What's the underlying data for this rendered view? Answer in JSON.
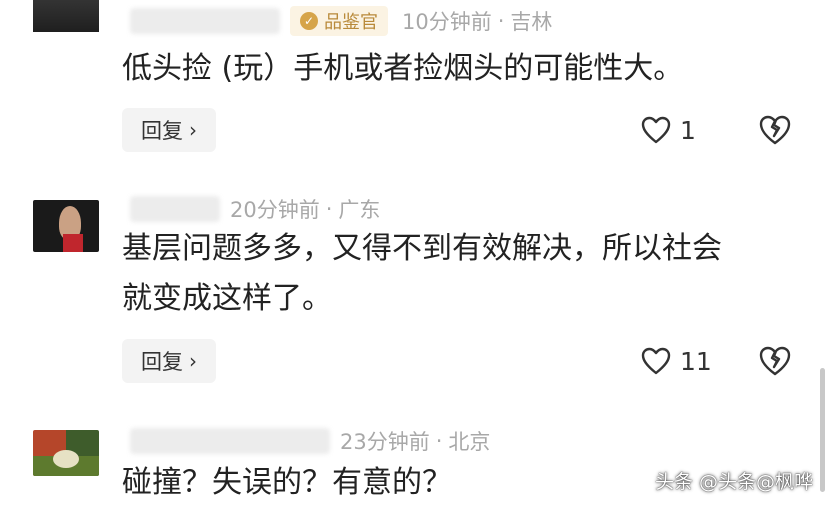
{
  "comments": [
    {
      "badge": "品鉴官",
      "time": "10分钟前",
      "location": "吉林",
      "text_lines": [
        "低头捡 (玩）手机或者捡烟头的可能性大。"
      ],
      "reply_label": "回复",
      "likes": "1"
    },
    {
      "time": "20分钟前",
      "location": "广东",
      "text_lines": [
        "基层问题多多，又得不到有效解决，所以社会",
        "就变成这样了。"
      ],
      "reply_label": "回复",
      "likes": "11"
    },
    {
      "time": "23分钟前",
      "location": "北京",
      "text_lines": [
        "碰撞？失误的？有意的？"
      ]
    }
  ],
  "separator": "·",
  "watermark": "头条 @头条@枫哗",
  "icons": {
    "badge": "badge-check-icon",
    "like": "heart-outline-icon",
    "dislike": "broken-heart-icon",
    "reply_arrow": "chevron-right-icon"
  }
}
